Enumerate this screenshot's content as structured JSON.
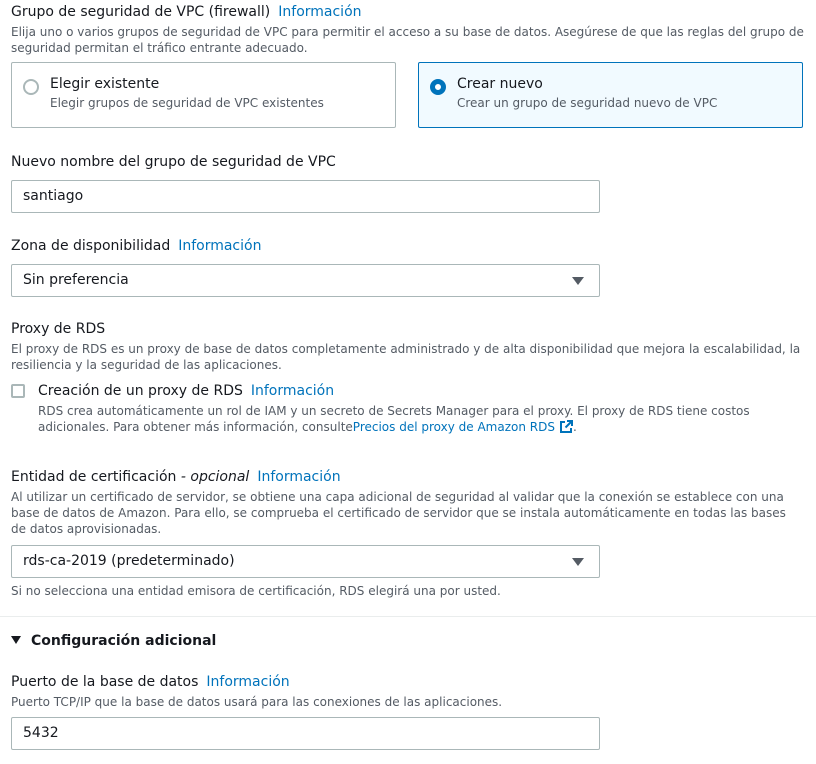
{
  "vpc_sg": {
    "label": "Grupo de seguridad de VPC (firewall)",
    "info": "Información",
    "desc": "Elija uno o varios grupos de seguridad de VPC para permitir el acceso a su base de datos. Asegúrese de que las reglas del grupo de seguridad permitan el tráfico entrante adecuado.",
    "options": [
      {
        "title": "Elegir existente",
        "sub": "Elegir grupos de seguridad de VPC existentes",
        "selected": false
      },
      {
        "title": "Crear nuevo",
        "sub": "Crear un grupo de seguridad nuevo de VPC",
        "selected": true
      }
    ]
  },
  "new_sg_name": {
    "label": "Nuevo nombre del grupo de seguridad de VPC",
    "value": "santiago"
  },
  "az": {
    "label": "Zona de disponibilidad",
    "info": "Información",
    "value": "Sin preferencia"
  },
  "rds_proxy": {
    "label": "Proxy de RDS",
    "desc": "El proxy de RDS es un proxy de base de datos completamente administrado y de alta disponibilidad que mejora la escalabilidad, la resiliencia y la seguridad de las aplicaciones.",
    "checkbox_label": "Creación de un proxy de RDS",
    "info": "Información",
    "checked": false,
    "checkbox_desc": "RDS crea automáticamente un rol de IAM y un secreto de Secrets Manager para el proxy. El proxy de RDS tiene costos adicionales. Para obtener más información, consulte",
    "link_text": "Precios del proxy de Amazon RDS",
    "after_link": "."
  },
  "cert": {
    "label": "Entidad de certificación",
    "optional": "- opcional",
    "info": "Información",
    "desc": "Al utilizar un certificado de servidor, se obtiene una capa adicional de seguridad al validar que la conexión se establece con una base de datos de Amazon. Para ello, se comprueba el certificado de servidor que se instala automáticamente en todas las bases de datos aprovisionadas.",
    "value": "rds-ca-2019 (predeterminado)",
    "hint": "Si no selecciona una entidad emisora de certificación, RDS elegirá una por usted."
  },
  "additional": {
    "title": "Configuración adicional"
  },
  "port": {
    "label": "Puerto de la base de datos",
    "info": "Información",
    "desc": "Puerto TCP/IP que la base de datos usará para las conexiones de las aplicaciones.",
    "value": "5432"
  },
  "colors": {
    "link": "#0073bb",
    "selected_bg": "#f1faff",
    "border": "#aab7b8"
  }
}
